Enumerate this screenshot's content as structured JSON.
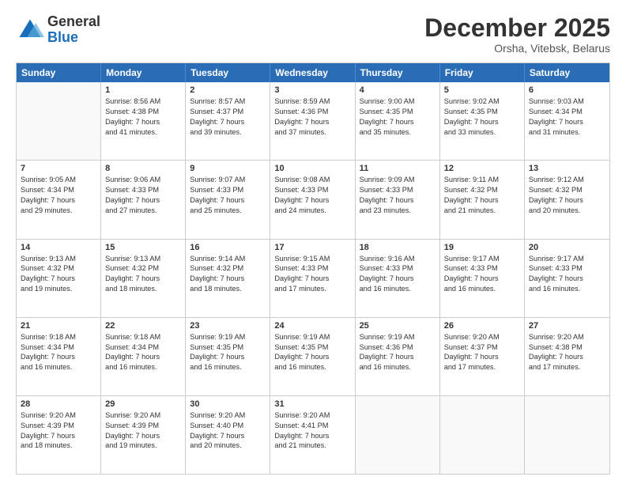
{
  "logo": {
    "general": "General",
    "blue": "Blue"
  },
  "header": {
    "month": "December 2025",
    "location": "Orsha, Vitebsk, Belarus"
  },
  "weekdays": [
    "Sunday",
    "Monday",
    "Tuesday",
    "Wednesday",
    "Thursday",
    "Friday",
    "Saturday"
  ],
  "weeks": [
    [
      {
        "day": "",
        "sunrise": "",
        "sunset": "",
        "daylight": ""
      },
      {
        "day": "1",
        "sunrise": "Sunrise: 8:56 AM",
        "sunset": "Sunset: 4:38 PM",
        "daylight": "Daylight: 7 hours and 41 minutes."
      },
      {
        "day": "2",
        "sunrise": "Sunrise: 8:57 AM",
        "sunset": "Sunset: 4:37 PM",
        "daylight": "Daylight: 7 hours and 39 minutes."
      },
      {
        "day": "3",
        "sunrise": "Sunrise: 8:59 AM",
        "sunset": "Sunset: 4:36 PM",
        "daylight": "Daylight: 7 hours and 37 minutes."
      },
      {
        "day": "4",
        "sunrise": "Sunrise: 9:00 AM",
        "sunset": "Sunset: 4:35 PM",
        "daylight": "Daylight: 7 hours and 35 minutes."
      },
      {
        "day": "5",
        "sunrise": "Sunrise: 9:02 AM",
        "sunset": "Sunset: 4:35 PM",
        "daylight": "Daylight: 7 hours and 33 minutes."
      },
      {
        "day": "6",
        "sunrise": "Sunrise: 9:03 AM",
        "sunset": "Sunset: 4:34 PM",
        "daylight": "Daylight: 7 hours and 31 minutes."
      }
    ],
    [
      {
        "day": "7",
        "sunrise": "Sunrise: 9:05 AM",
        "sunset": "Sunset: 4:34 PM",
        "daylight": "Daylight: 7 hours and 29 minutes."
      },
      {
        "day": "8",
        "sunrise": "Sunrise: 9:06 AM",
        "sunset": "Sunset: 4:33 PM",
        "daylight": "Daylight: 7 hours and 27 minutes."
      },
      {
        "day": "9",
        "sunrise": "Sunrise: 9:07 AM",
        "sunset": "Sunset: 4:33 PM",
        "daylight": "Daylight: 7 hours and 25 minutes."
      },
      {
        "day": "10",
        "sunrise": "Sunrise: 9:08 AM",
        "sunset": "Sunset: 4:33 PM",
        "daylight": "Daylight: 7 hours and 24 minutes."
      },
      {
        "day": "11",
        "sunrise": "Sunrise: 9:09 AM",
        "sunset": "Sunset: 4:33 PM",
        "daylight": "Daylight: 7 hours and 23 minutes."
      },
      {
        "day": "12",
        "sunrise": "Sunrise: 9:11 AM",
        "sunset": "Sunset: 4:32 PM",
        "daylight": "Daylight: 7 hours and 21 minutes."
      },
      {
        "day": "13",
        "sunrise": "Sunrise: 9:12 AM",
        "sunset": "Sunset: 4:32 PM",
        "daylight": "Daylight: 7 hours and 20 minutes."
      }
    ],
    [
      {
        "day": "14",
        "sunrise": "Sunrise: 9:13 AM",
        "sunset": "Sunset: 4:32 PM",
        "daylight": "Daylight: 7 hours and 19 minutes."
      },
      {
        "day": "15",
        "sunrise": "Sunrise: 9:13 AM",
        "sunset": "Sunset: 4:32 PM",
        "daylight": "Daylight: 7 hours and 18 minutes."
      },
      {
        "day": "16",
        "sunrise": "Sunrise: 9:14 AM",
        "sunset": "Sunset: 4:32 PM",
        "daylight": "Daylight: 7 hours and 18 minutes."
      },
      {
        "day": "17",
        "sunrise": "Sunrise: 9:15 AM",
        "sunset": "Sunset: 4:33 PM",
        "daylight": "Daylight: 7 hours and 17 minutes."
      },
      {
        "day": "18",
        "sunrise": "Sunrise: 9:16 AM",
        "sunset": "Sunset: 4:33 PM",
        "daylight": "Daylight: 7 hours and 16 minutes."
      },
      {
        "day": "19",
        "sunrise": "Sunrise: 9:17 AM",
        "sunset": "Sunset: 4:33 PM",
        "daylight": "Daylight: 7 hours and 16 minutes."
      },
      {
        "day": "20",
        "sunrise": "Sunrise: 9:17 AM",
        "sunset": "Sunset: 4:33 PM",
        "daylight": "Daylight: 7 hours and 16 minutes."
      }
    ],
    [
      {
        "day": "21",
        "sunrise": "Sunrise: 9:18 AM",
        "sunset": "Sunset: 4:34 PM",
        "daylight": "Daylight: 7 hours and 16 minutes."
      },
      {
        "day": "22",
        "sunrise": "Sunrise: 9:18 AM",
        "sunset": "Sunset: 4:34 PM",
        "daylight": "Daylight: 7 hours and 16 minutes."
      },
      {
        "day": "23",
        "sunrise": "Sunrise: 9:19 AM",
        "sunset": "Sunset: 4:35 PM",
        "daylight": "Daylight: 7 hours and 16 minutes."
      },
      {
        "day": "24",
        "sunrise": "Sunrise: 9:19 AM",
        "sunset": "Sunset: 4:35 PM",
        "daylight": "Daylight: 7 hours and 16 minutes."
      },
      {
        "day": "25",
        "sunrise": "Sunrise: 9:19 AM",
        "sunset": "Sunset: 4:36 PM",
        "daylight": "Daylight: 7 hours and 16 minutes."
      },
      {
        "day": "26",
        "sunrise": "Sunrise: 9:20 AM",
        "sunset": "Sunset: 4:37 PM",
        "daylight": "Daylight: 7 hours and 17 minutes."
      },
      {
        "day": "27",
        "sunrise": "Sunrise: 9:20 AM",
        "sunset": "Sunset: 4:38 PM",
        "daylight": "Daylight: 7 hours and 17 minutes."
      }
    ],
    [
      {
        "day": "28",
        "sunrise": "Sunrise: 9:20 AM",
        "sunset": "Sunset: 4:39 PM",
        "daylight": "Daylight: 7 hours and 18 minutes."
      },
      {
        "day": "29",
        "sunrise": "Sunrise: 9:20 AM",
        "sunset": "Sunset: 4:39 PM",
        "daylight": "Daylight: 7 hours and 19 minutes."
      },
      {
        "day": "30",
        "sunrise": "Sunrise: 9:20 AM",
        "sunset": "Sunset: 4:40 PM",
        "daylight": "Daylight: 7 hours and 20 minutes."
      },
      {
        "day": "31",
        "sunrise": "Sunrise: 9:20 AM",
        "sunset": "Sunset: 4:41 PM",
        "daylight": "Daylight: 7 hours and 21 minutes."
      },
      {
        "day": "",
        "sunrise": "",
        "sunset": "",
        "daylight": ""
      },
      {
        "day": "",
        "sunrise": "",
        "sunset": "",
        "daylight": ""
      },
      {
        "day": "",
        "sunrise": "",
        "sunset": "",
        "daylight": ""
      }
    ]
  ]
}
